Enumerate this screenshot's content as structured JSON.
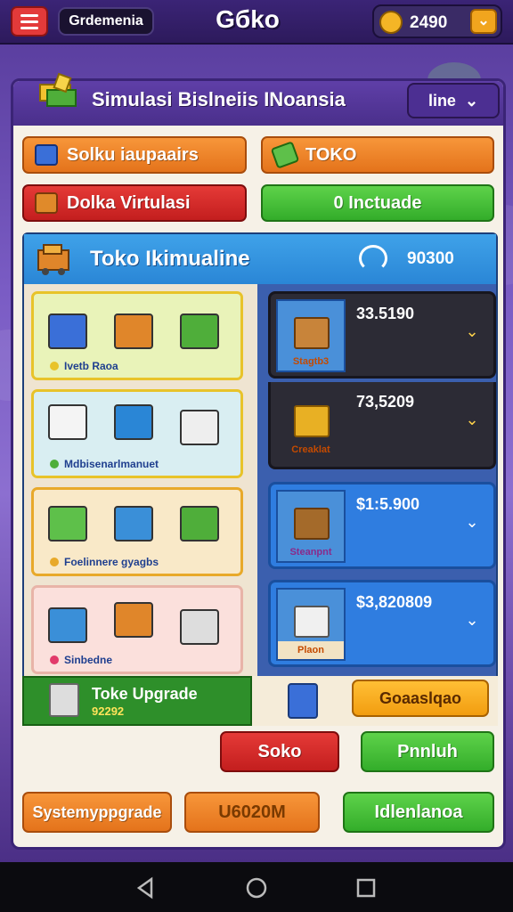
{
  "topbar": {
    "username": "Grdemenia",
    "game_title": "Gбko",
    "coins": "2490"
  },
  "panel": {
    "title": "Simulasi Bislneiis INoansia",
    "dropdown": "line"
  },
  "actions": {
    "btn1": "Solku iaupaairs",
    "btn2": "TOKO",
    "btn3": "Dolka Virtulasi",
    "btn4": "0 Inctuade"
  },
  "store": {
    "title": "Toko Ikimualine",
    "balance": "90300",
    "categories": [
      {
        "label": "Ivetb Raoa"
      },
      {
        "label": "Mdbisenarlmanuet"
      },
      {
        "label": "Foelinnere gyagbs"
      },
      {
        "label": "Sinbedne"
      }
    ],
    "products": [
      {
        "price": "33.5190",
        "name": "Stagtb3"
      },
      {
        "price": "73,5209",
        "name": "Creaklat"
      },
      {
        "price": "$1:5.900",
        "name": "Steanpnt"
      },
      {
        "price": "$3,820809",
        "name": "Plaon"
      }
    ]
  },
  "upgrade": {
    "title": "Toke Upgrade",
    "sub": "92292",
    "button": "Goaaslqao"
  },
  "bottom": {
    "red_btn": "Soko",
    "green_btn": "Pnnluh",
    "system_upgrade": "Systemyppgrade",
    "value_btn": "U6020M",
    "maintenance": "Idlenlanoa"
  },
  "colors": {
    "accent": "#4a2f8b",
    "orange": "#e4731b",
    "green": "#33ad2a",
    "red": "#c31e1e",
    "blue": "#2a86d6"
  }
}
